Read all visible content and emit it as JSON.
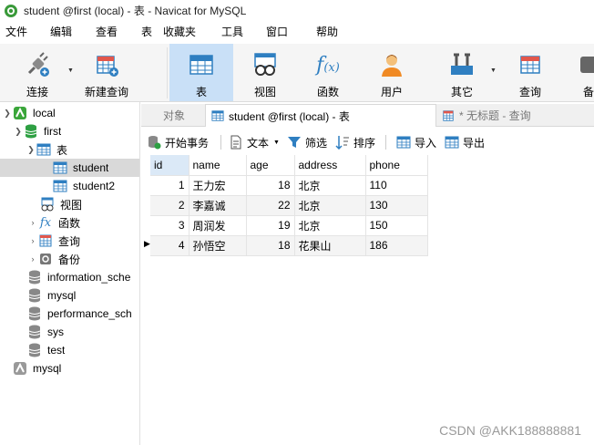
{
  "window": {
    "title": "student @first (local) - 表 - Navicat for MySQL"
  },
  "menu": [
    "文件",
    "编辑",
    "查看",
    "表",
    "收藏夹",
    "工具",
    "窗口",
    "帮助"
  ],
  "toolbar": {
    "connect": "连接",
    "new_query": "新建查询",
    "table": "表",
    "view": "视图",
    "function": "函数",
    "user": "用户",
    "other": "其它",
    "query": "查询",
    "backup": "备"
  },
  "tree": {
    "local": "local",
    "first": "first",
    "tables": "表",
    "student": "student",
    "student2": "student2",
    "views": "视图",
    "functions": "函数",
    "queries": "查询",
    "backups": "备份",
    "information_schema": "information_sche",
    "mysql": "mysql",
    "performance_schema": "performance_sch",
    "sys": "sys",
    "test": "test",
    "mysql_conn": "mysql"
  },
  "tabs": {
    "objects": "对象",
    "student": "student @first (local) - 表",
    "untitled": "* 无标题 - 查询"
  },
  "object_toolbar": {
    "begin_transaction": "开始事务",
    "text": "文本",
    "filter": "筛选",
    "sort": "排序",
    "import": "导入",
    "export": "导出"
  },
  "table": {
    "columns": [
      "id",
      "name",
      "age",
      "address",
      "phone"
    ],
    "rows": [
      {
        "id": "1",
        "name": "王力宏",
        "age": "18",
        "address": "北京",
        "phone": "110"
      },
      {
        "id": "2",
        "name": "李嘉诚",
        "age": "22",
        "address": "北京",
        "phone": "130"
      },
      {
        "id": "3",
        "name": "周润发",
        "age": "19",
        "address": "北京",
        "phone": "150"
      },
      {
        "id": "4",
        "name": "孙悟空",
        "age": "18",
        "address": "花果山",
        "phone": "186"
      }
    ]
  },
  "watermark": "CSDN @AKK188888881",
  "colors": {
    "active_tool": "#c9e0f7",
    "selected_row": "#d9d9d9",
    "db_green": "#2ea043",
    "accent_blue": "#2f7fc1"
  }
}
